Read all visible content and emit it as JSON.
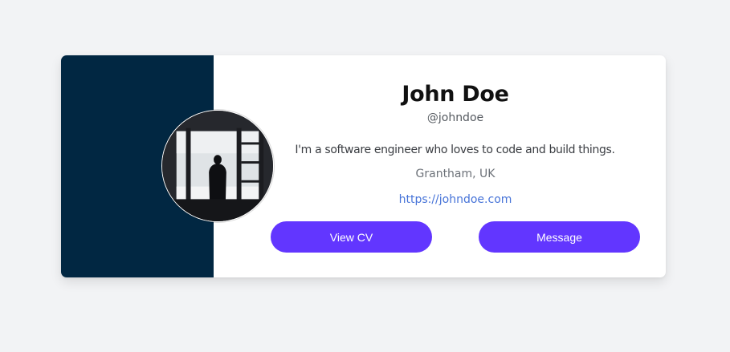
{
  "profile": {
    "name": "John Doe",
    "handle": "@johndoe",
    "bio": "I'm a software engineer who loves to code and build things.",
    "location": "Grantham, UK",
    "website": "https://johndoe.com"
  },
  "actions": {
    "view_cv_label": "View CV",
    "message_label": "Message"
  },
  "colors": {
    "side_band": "#012742",
    "accent": "#6236ff",
    "link": "#4673d8"
  }
}
